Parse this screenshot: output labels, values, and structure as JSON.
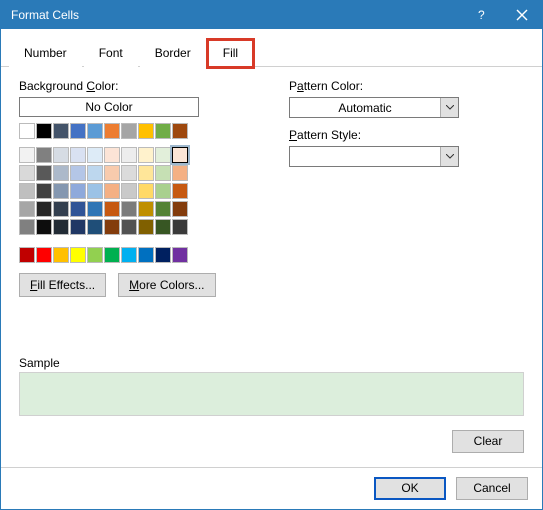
{
  "title": "Format Cells",
  "tabs": [
    "Number",
    "Font",
    "Border",
    "Fill"
  ],
  "active_tab": "Fill",
  "left": {
    "bg_label": "Background Color:",
    "no_color": "No Color",
    "fill_effects": "Fill Effects...",
    "more_colors": "More Colors..."
  },
  "right": {
    "pattern_color_label": "Pattern Color:",
    "pattern_color_value": "Automatic",
    "pattern_style_label": "Pattern Style:",
    "pattern_style_value": ""
  },
  "palette": {
    "row0": [
      "#ffffff",
      "#000000",
      "#44546a",
      "#4472c4",
      "#5b9bd5",
      "#ed7d31",
      "#a5a5a5",
      "#ffc000",
      "#70ad47",
      "#9e480e"
    ],
    "rows": [
      [
        "#f2f2f2",
        "#808080",
        "#d6dce4",
        "#d9e1f2",
        "#ddebf7",
        "#fce4d6",
        "#ededed",
        "#fff2cc",
        "#e2efda",
        "#fbe5d6"
      ],
      [
        "#d9d9d9",
        "#595959",
        "#acb9ca",
        "#b4c6e7",
        "#bdd7ee",
        "#f8cbad",
        "#dbdbdb",
        "#ffe699",
        "#c6e0b4",
        "#f4b084"
      ],
      [
        "#bfbfbf",
        "#404040",
        "#8497b0",
        "#8ea9db",
        "#9bc2e6",
        "#f4b084",
        "#c9c9c9",
        "#ffd966",
        "#a9d08e",
        "#c65911"
      ],
      [
        "#a6a6a6",
        "#262626",
        "#333f4f",
        "#305496",
        "#2f75b5",
        "#c65911",
        "#7b7b7b",
        "#bf8f00",
        "#548235",
        "#833c0c"
      ],
      [
        "#808080",
        "#0d0d0d",
        "#222b35",
        "#203764",
        "#1f4e78",
        "#833c0c",
        "#525252",
        "#806000",
        "#375623",
        "#3a3a3a"
      ]
    ],
    "standard": [
      "#c00000",
      "#ff0000",
      "#ffc000",
      "#ffff00",
      "#92d050",
      "#00b050",
      "#00b0f0",
      "#0070c0",
      "#002060",
      "#7030a0"
    ],
    "selected": {
      "group": "rows",
      "r": 0,
      "c": 9
    }
  },
  "sample": {
    "label": "Sample",
    "color": "#dceedc"
  },
  "buttons": {
    "clear": "Clear",
    "ok": "OK",
    "cancel": "Cancel"
  }
}
